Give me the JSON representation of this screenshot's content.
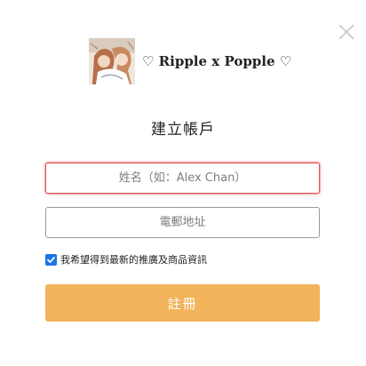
{
  "modal": {
    "close_icon": "close-icon"
  },
  "brand": {
    "shop_name": "♡ Ripple x Popple ♡",
    "logo_icon": "shop-logo"
  },
  "form": {
    "title": "建立帳戶",
    "name_placeholder": "姓名（如：Alex Chan）",
    "name_value": "",
    "email_placeholder": "電郵地址",
    "email_value": "",
    "consent_label": "我希望得到最新的推廣及商品資訊",
    "consent_checked": true,
    "submit_label": "註冊"
  },
  "colors": {
    "accent": "#f2b35a",
    "error_border": "#e25555",
    "checkbox": "#1a73e8"
  }
}
